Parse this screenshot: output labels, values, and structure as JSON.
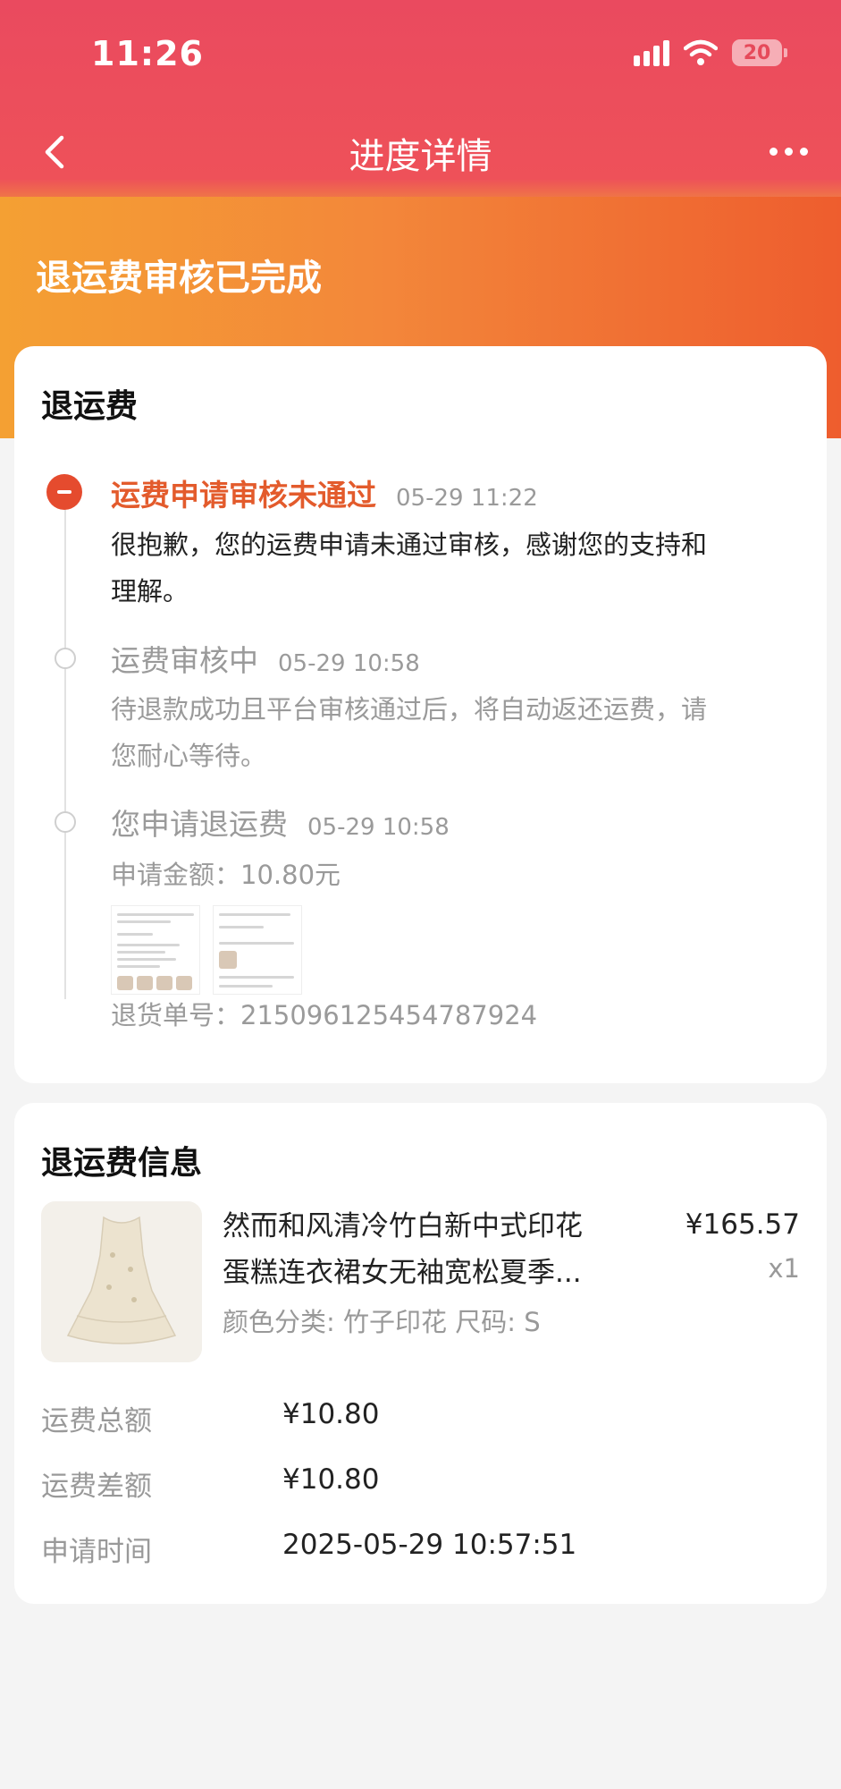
{
  "status_bar": {
    "time": "11:26",
    "battery": "20"
  },
  "nav": {
    "title": "进度详情"
  },
  "hero": {
    "title": "退运费审核已完成"
  },
  "progress": {
    "section_title": "退运费",
    "steps": [
      {
        "title": "运费申请审核未通过",
        "time": "05-29 11:22",
        "lines": [
          "很抱歉，您的运费申请未通过审核，感谢您的支持和",
          "理解。"
        ]
      },
      {
        "title": "运费审核中",
        "time": "05-29 10:58",
        "lines": [
          "待退款成功且平台审核通过后，将自动返还运费，请",
          "您耐心等待。"
        ]
      },
      {
        "title": "您申请退运费",
        "time": "05-29 10:58",
        "amount": "申请金额：10.80元",
        "tracking": "退货单号：215096125454787924"
      }
    ]
  },
  "info": {
    "section_title": "退运费信息",
    "product": {
      "name_line1": "然而和风清冷竹白新中式印花",
      "name_line2": "蛋糕连衣裙女无袖宽松夏季...",
      "spec": "颜色分类: 竹子印花 尺码: S",
      "price": "¥165.57",
      "qty": "x1"
    },
    "rows": [
      {
        "label": "运费总额",
        "value": "¥10.80"
      },
      {
        "label": "运费差额",
        "value": "¥10.80"
      },
      {
        "label": "申请时间",
        "value": "2025-05-29 10:57:51"
      }
    ]
  }
}
